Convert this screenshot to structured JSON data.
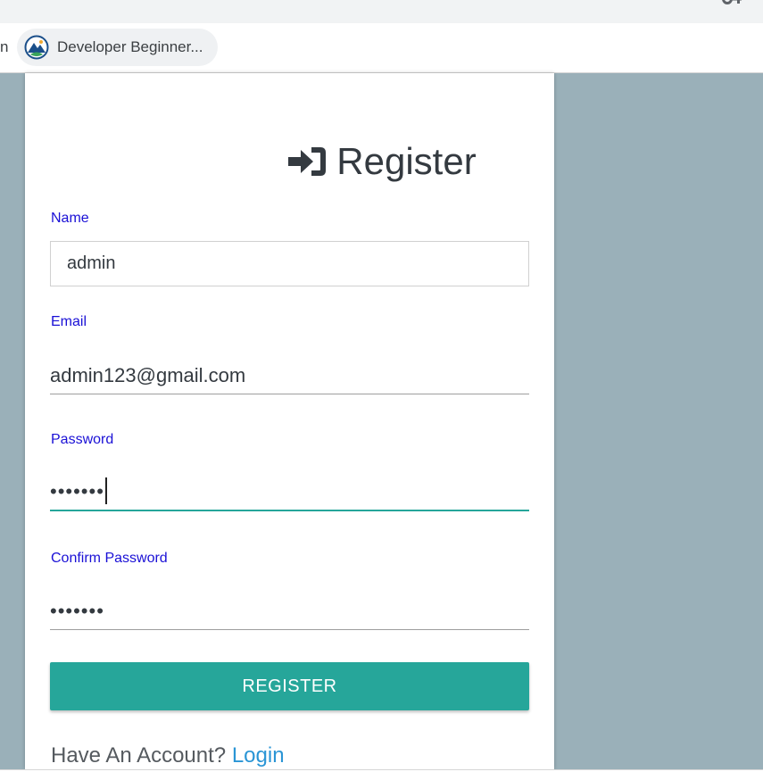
{
  "browser": {
    "bookmark_partial": "n",
    "bookmark_chip_label": "Developer Beginner..."
  },
  "form": {
    "title": "Register",
    "name_label": "Name",
    "name_value": "admin",
    "email_label": "Email",
    "email_value": "admin123@gmail.com",
    "password_label": "Password",
    "password_value": "•••••••",
    "confirm_label": "Confirm Password",
    "confirm_value": "•••••••",
    "submit_label": "REGISTER",
    "footer_prompt": "Have An Account?",
    "footer_link": "Login"
  },
  "colors": {
    "accent": "#26a69a",
    "label": "#1a10d6",
    "link": "#2a95d5",
    "page_bg": "#9ab0b9"
  },
  "icons": {
    "browser_key": "key-icon",
    "bookmark": "trailhead-icon",
    "title": "sign-in-icon"
  }
}
